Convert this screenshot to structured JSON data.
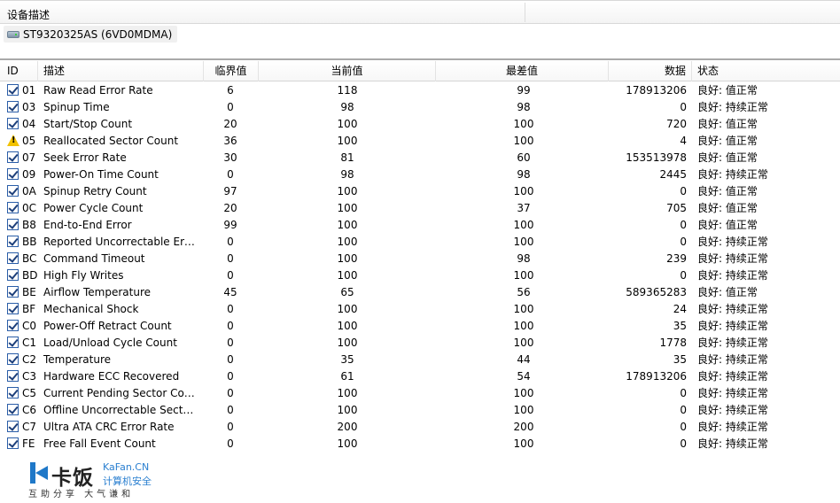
{
  "device_panel": {
    "column_label": "设备描述",
    "device_name": "ST9320325AS (6VD0MDMA)"
  },
  "table": {
    "headers": {
      "id": "ID",
      "name": "描述",
      "threshold": "临界值",
      "current": "当前值",
      "worst": "最差值",
      "data": "数据",
      "status": "状态"
    },
    "rows": [
      {
        "icon": "checkbox-checked",
        "id": "01",
        "name": "Raw Read Error Rate",
        "threshold": "6",
        "current": "118",
        "worst": "99",
        "data": "178913206",
        "status": "良好: 值正常"
      },
      {
        "icon": "checkbox-checked",
        "id": "03",
        "name": "Spinup Time",
        "threshold": "0",
        "current": "98",
        "worst": "98",
        "data": "0",
        "status": "良好: 持续正常"
      },
      {
        "icon": "checkbox-checked",
        "id": "04",
        "name": "Start/Stop Count",
        "threshold": "20",
        "current": "100",
        "worst": "100",
        "data": "720",
        "status": "良好: 值正常"
      },
      {
        "icon": "warning",
        "id": "05",
        "name": "Reallocated Sector Count",
        "threshold": "36",
        "current": "100",
        "worst": "100",
        "data": "4",
        "status": "良好: 值正常"
      },
      {
        "icon": "checkbox-checked",
        "id": "07",
        "name": "Seek Error Rate",
        "threshold": "30",
        "current": "81",
        "worst": "60",
        "data": "153513978",
        "status": "良好: 值正常"
      },
      {
        "icon": "checkbox-checked",
        "id": "09",
        "name": "Power-On Time Count",
        "threshold": "0",
        "current": "98",
        "worst": "98",
        "data": "2445",
        "status": "良好: 持续正常"
      },
      {
        "icon": "checkbox-checked",
        "id": "0A",
        "name": "Spinup Retry Count",
        "threshold": "97",
        "current": "100",
        "worst": "100",
        "data": "0",
        "status": "良好: 值正常"
      },
      {
        "icon": "checkbox-checked",
        "id": "0C",
        "name": "Power Cycle Count",
        "threshold": "20",
        "current": "100",
        "worst": "37",
        "data": "705",
        "status": "良好: 值正常"
      },
      {
        "icon": "checkbox-checked",
        "id": "B8",
        "name": "End-to-End Error",
        "threshold": "99",
        "current": "100",
        "worst": "100",
        "data": "0",
        "status": "良好: 值正常"
      },
      {
        "icon": "checkbox-checked",
        "id": "BB",
        "name": "Reported Uncorrectable Errors",
        "threshold": "0",
        "current": "100",
        "worst": "100",
        "data": "0",
        "status": "良好: 持续正常"
      },
      {
        "icon": "checkbox-checked",
        "id": "BC",
        "name": "Command Timeout",
        "threshold": "0",
        "current": "100",
        "worst": "98",
        "data": "239",
        "status": "良好: 持续正常"
      },
      {
        "icon": "checkbox-checked",
        "id": "BD",
        "name": "High Fly Writes",
        "threshold": "0",
        "current": "100",
        "worst": "100",
        "data": "0",
        "status": "良好: 持续正常"
      },
      {
        "icon": "checkbox-checked",
        "id": "BE",
        "name": "Airflow Temperature",
        "threshold": "45",
        "current": "65",
        "worst": "56",
        "data": "589365283",
        "status": "良好: 值正常"
      },
      {
        "icon": "checkbox-checked",
        "id": "BF",
        "name": "Mechanical Shock",
        "threshold": "0",
        "current": "100",
        "worst": "100",
        "data": "24",
        "status": "良好: 持续正常"
      },
      {
        "icon": "checkbox-checked",
        "id": "C0",
        "name": "Power-Off Retract Count",
        "threshold": "0",
        "current": "100",
        "worst": "100",
        "data": "35",
        "status": "良好: 持续正常"
      },
      {
        "icon": "checkbox-checked",
        "id": "C1",
        "name": "Load/Unload Cycle Count",
        "threshold": "0",
        "current": "100",
        "worst": "100",
        "data": "1778",
        "status": "良好: 持续正常"
      },
      {
        "icon": "checkbox-checked",
        "id": "C2",
        "name": "Temperature",
        "threshold": "0",
        "current": "35",
        "worst": "44",
        "data": "35",
        "status": "良好: 持续正常"
      },
      {
        "icon": "checkbox-checked",
        "id": "C3",
        "name": "Hardware ECC Recovered",
        "threshold": "0",
        "current": "61",
        "worst": "54",
        "data": "178913206",
        "status": "良好: 持续正常"
      },
      {
        "icon": "checkbox-checked",
        "id": "C5",
        "name": "Current Pending Sector Count",
        "threshold": "0",
        "current": "100",
        "worst": "100",
        "data": "0",
        "status": "良好: 持续正常"
      },
      {
        "icon": "checkbox-checked",
        "id": "C6",
        "name": "Offline Uncorrectable Sector C...",
        "threshold": "0",
        "current": "100",
        "worst": "100",
        "data": "0",
        "status": "良好: 持续正常"
      },
      {
        "icon": "checkbox-checked",
        "id": "C7",
        "name": "Ultra ATA CRC Error Rate",
        "threshold": "0",
        "current": "200",
        "worst": "200",
        "data": "0",
        "status": "良好: 持续正常"
      },
      {
        "icon": "checkbox-checked",
        "id": "FE",
        "name": "Free Fall Event Count",
        "threshold": "0",
        "current": "100",
        "worst": "100",
        "data": "0",
        "status": "良好: 持续正常"
      }
    ]
  },
  "watermark": {
    "brand_cn": "卡饭",
    "brand_en": "KaFan.CN",
    "tagline": "计算机安全",
    "slogan": "互助分享  大气谦和"
  },
  "colors": {
    "checkbox_border": "#2b5ea8",
    "warning": "#f2c200",
    "logo_blue": "#1f78c8"
  }
}
